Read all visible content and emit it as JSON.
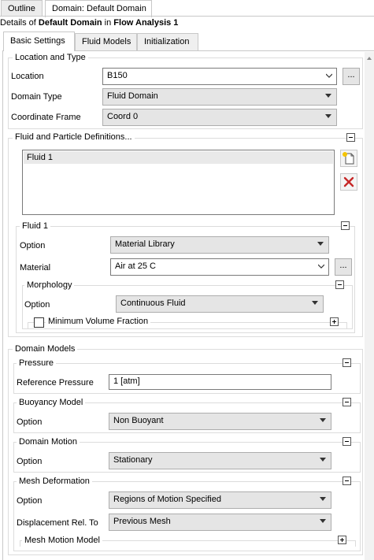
{
  "top_tabs": [
    {
      "label": "Outline"
    },
    {
      "label": "Domain: Default Domain"
    }
  ],
  "details": {
    "prefix": "Details of ",
    "object": "Default Domain",
    "middle": " in ",
    "analysis": "Flow Analysis 1"
  },
  "sub_tabs": [
    {
      "label": "Basic Settings"
    },
    {
      "label": "Fluid Models"
    },
    {
      "label": "Initialization"
    }
  ],
  "location_and_type": {
    "title": "Location and Type",
    "location_label": "Location",
    "location_value": "B150",
    "location_button": "...",
    "domain_type_label": "Domain Type",
    "domain_type_value": "Fluid Domain",
    "coord_frame_label": "Coordinate Frame",
    "coord_frame_value": "Coord 0"
  },
  "fluid_defs": {
    "title": "Fluid and Particle Definitions...",
    "items": [
      "Fluid 1"
    ],
    "fluid1": {
      "title": "Fluid 1",
      "option_label": "Option",
      "option_value": "Material Library",
      "material_label": "Material",
      "material_value": "Air at 25 C",
      "material_button": "...",
      "morphology": {
        "title": "Morphology",
        "option_label": "Option",
        "option_value": "Continuous Fluid",
        "min_vol_label": "Minimum Volume Fraction"
      }
    }
  },
  "domain_models": {
    "title": "Domain Models",
    "pressure": {
      "title": "Pressure",
      "ref_label": "Reference Pressure",
      "ref_value": "1 [atm]"
    },
    "buoyancy": {
      "title": "Buoyancy Model",
      "option_label": "Option",
      "option_value": "Non Buoyant"
    },
    "motion": {
      "title": "Domain Motion",
      "option_label": "Option",
      "option_value": "Stationary"
    },
    "mesh": {
      "title": "Mesh Deformation",
      "option_label": "Option",
      "option_value": "Regions of Motion Specified",
      "disp_label": "Displacement Rel. To",
      "disp_value": "Previous Mesh",
      "mesh_motion_label": "Mesh Motion Model"
    }
  }
}
